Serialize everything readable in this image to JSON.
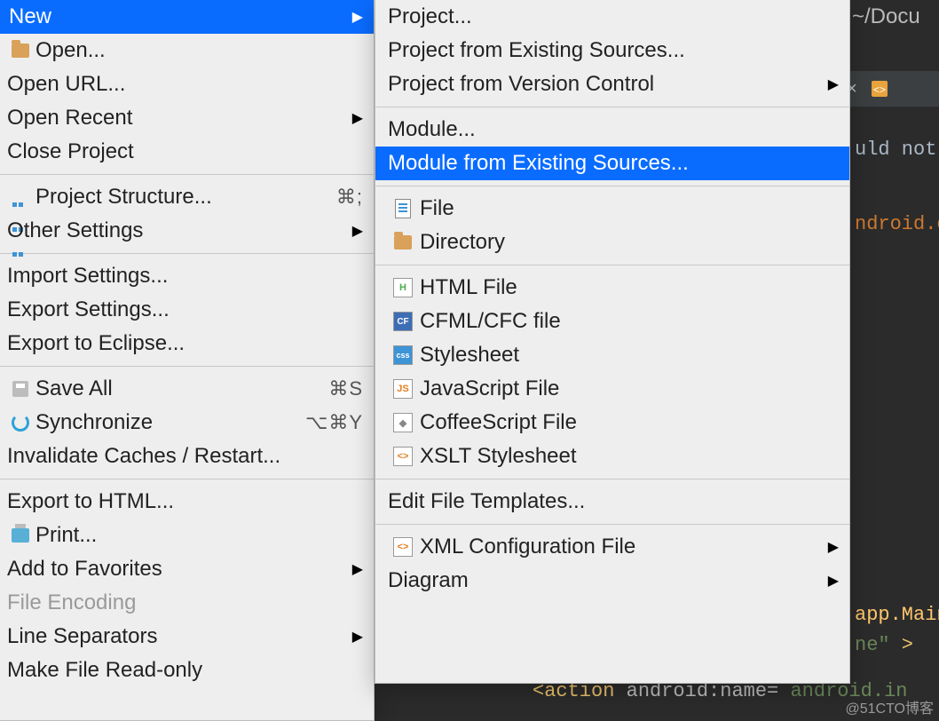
{
  "editor": {
    "path_fragment": "~/Docu",
    "line1": "uld not",
    "line2": "ndroid.c",
    "line3": "app.Main",
    "line4_a": "ne\"",
    "line4_b": " >",
    "line5_a": "<",
    "line5_b": "action ",
    "line5_c": "android",
    "line5_d": ":name= ",
    "line5_e": "android.in"
  },
  "menu1": {
    "new": "New",
    "open": "Open...",
    "open_url": "Open URL...",
    "open_recent": "Open Recent",
    "close_project": "Close Project",
    "project_structure": "Project Structure...",
    "project_structure_shortcut": "⌘;",
    "other_settings": "Other Settings",
    "import_settings": "Import Settings...",
    "export_settings": "Export Settings...",
    "export_eclipse": "Export to Eclipse...",
    "save_all": "Save All",
    "save_all_shortcut": "⌘S",
    "synchronize": "Synchronize",
    "synchronize_shortcut": "⌥⌘Y",
    "invalidate": "Invalidate Caches / Restart...",
    "export_html": "Export to HTML...",
    "print": "Print...",
    "add_fav": "Add to Favorites",
    "file_encoding": "File Encoding",
    "line_sep": "Line Separators",
    "make_ro": "Make File Read-only"
  },
  "menu2": {
    "project": "Project...",
    "project_existing": "Project from Existing Sources...",
    "project_vcs": "Project from Version Control",
    "module": "Module...",
    "module_existing": "Module from Existing Sources...",
    "file": "File",
    "directory": "Directory",
    "html_file": "HTML File",
    "cfml": "CFML/CFC file",
    "stylesheet": "Stylesheet",
    "js_file": "JavaScript File",
    "coffee": "CoffeeScript File",
    "xslt": "XSLT Stylesheet",
    "edit_templates": "Edit File Templates...",
    "xml_config": "XML Configuration File",
    "diagram": "Diagram"
  },
  "watermark": "@51CTO博客"
}
